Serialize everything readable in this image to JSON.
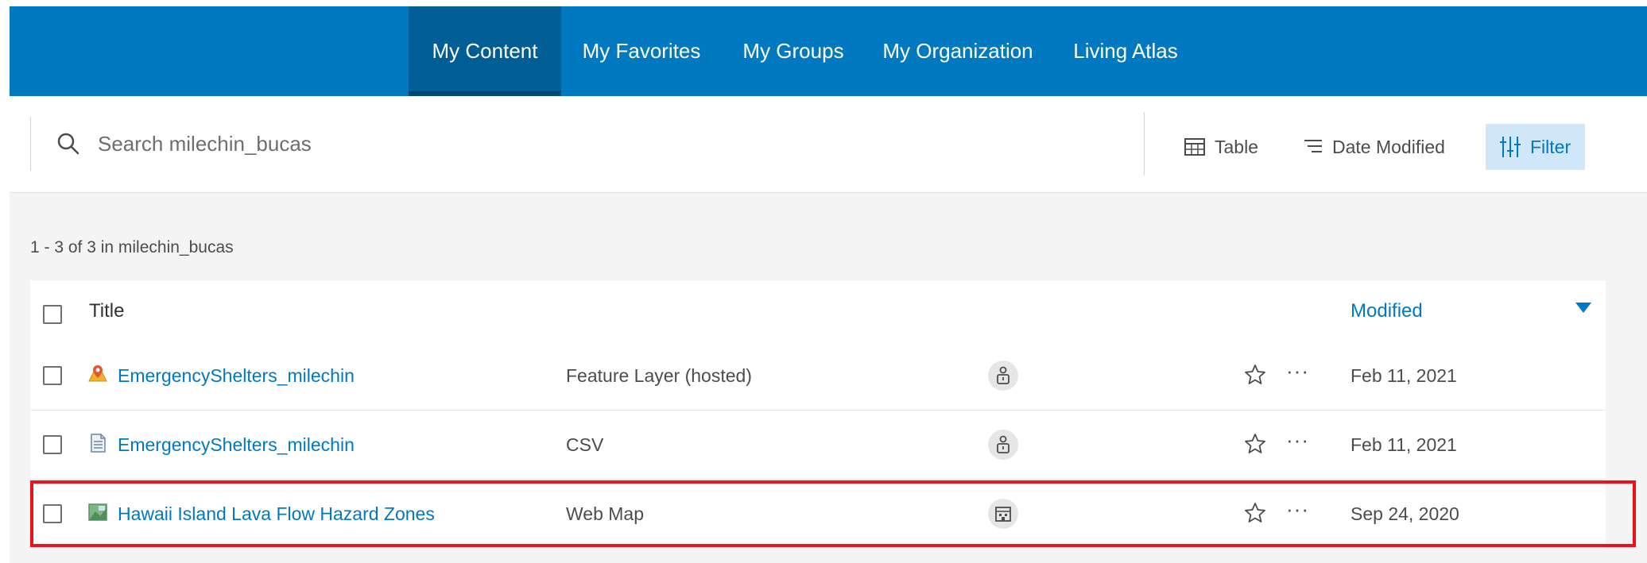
{
  "nav": {
    "tabs": [
      {
        "label": "My Content",
        "active": true
      },
      {
        "label": "My Favorites",
        "active": false
      },
      {
        "label": "My Groups",
        "active": false
      },
      {
        "label": "My Organization",
        "active": false
      },
      {
        "label": "Living Atlas",
        "active": false
      }
    ]
  },
  "toolbar": {
    "search_placeholder": "Search milechin_bucas",
    "table_label": "Table",
    "sort_label": "Date Modified",
    "filter_label": "Filter"
  },
  "results": {
    "count_text": "1 - 3 of 3 in milechin_bucas",
    "columns": {
      "title": "Title",
      "modified": "Modified"
    },
    "items": [
      {
        "title": "EmergencyShelters_milechin",
        "type": "Feature Layer (hosted)",
        "modified": "Feb 11, 2021",
        "icon": "feature-layer-icon",
        "sharing": "private"
      },
      {
        "title": "EmergencyShelters_milechin",
        "type": "CSV",
        "modified": "Feb 11, 2021",
        "icon": "csv-file-icon",
        "sharing": "private"
      },
      {
        "title": "Hawaii Island Lava Flow Hazard Zones",
        "type": "Web Map",
        "modified": "Sep 24, 2020",
        "icon": "web-map-icon",
        "sharing": "organization"
      }
    ]
  },
  "colors": {
    "brand": "#0079c1",
    "nav_active": "#005e95",
    "highlight": "#e8141a"
  }
}
